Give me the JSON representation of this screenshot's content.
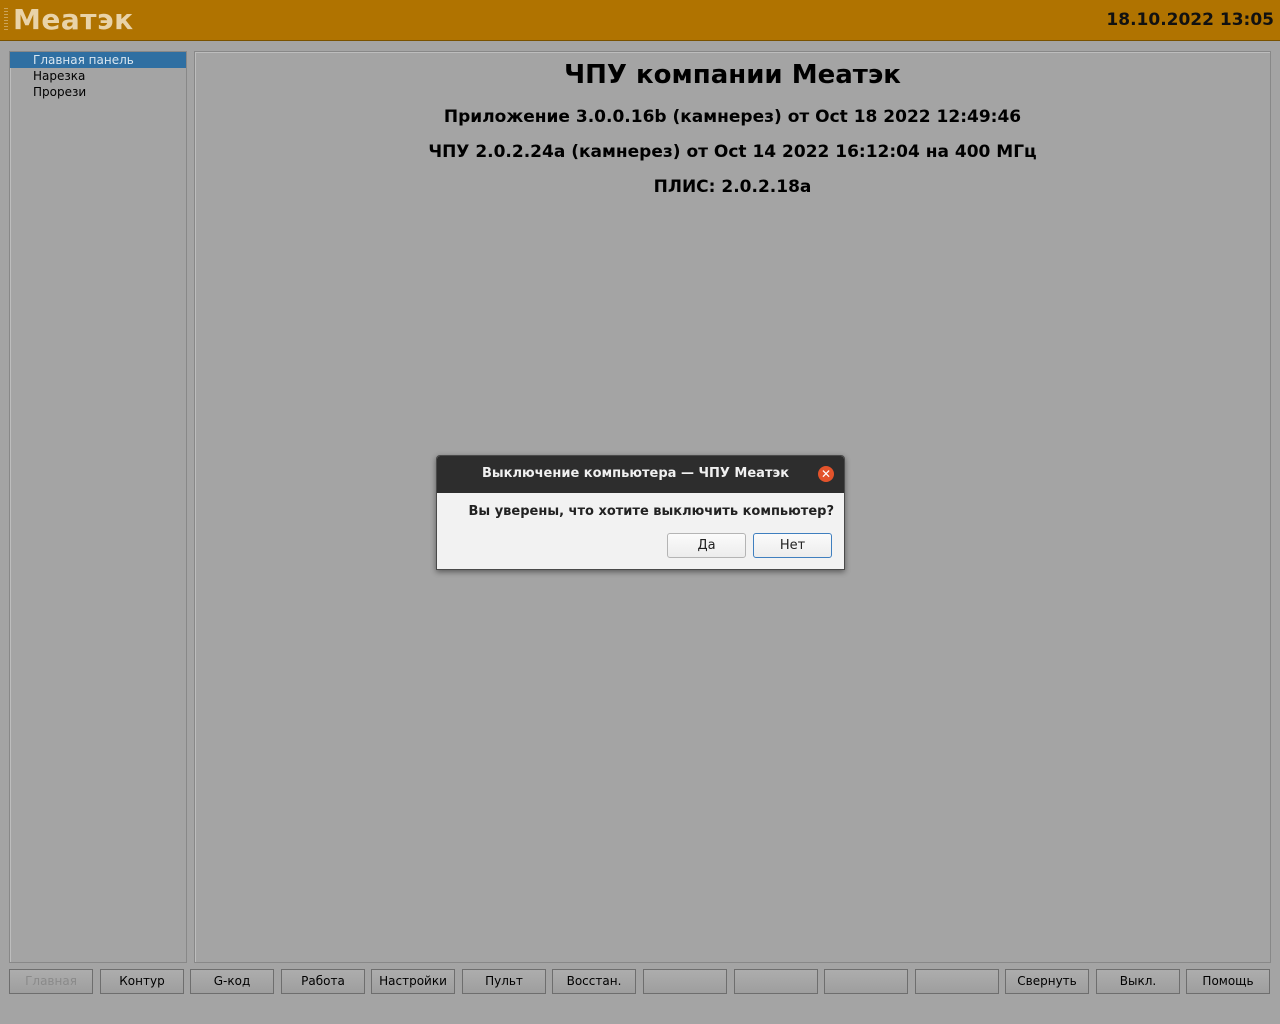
{
  "header": {
    "app_title": "Меатэк",
    "datetime": "18.10.2022 13:05"
  },
  "sidebar": {
    "items": [
      {
        "label": "Главная панель",
        "active": true
      },
      {
        "label": "Нарезка",
        "active": false
      },
      {
        "label": "Прорези",
        "active": false
      }
    ]
  },
  "main": {
    "title": "ЧПУ компании Меатэк",
    "app_version": "Приложение 3.0.0.16b (камнерез) от Oct 18 2022 12:49:46",
    "cnc_version": "ЧПУ 2.0.2.24a (камнерез) от Oct 14 2022 16:12:04 на 400 МГц",
    "fpga_version": "ПЛИС: 2.0.2.18a"
  },
  "footer": {
    "buttons": [
      "Главная",
      "Контур",
      "G-код",
      "Работа",
      "Настройки",
      "Пульт",
      "Восстан.",
      "",
      "",
      "",
      "",
      "Свернуть",
      "Выкл.",
      "Помощь"
    ],
    "disabled_index": 0
  },
  "dialog": {
    "title": "Выключение компьютера — ЧПУ Меатэк",
    "message": "Вы уверены, что хотите выключить компьютер?",
    "yes_label": "Да",
    "no_label": "Нет",
    "close_glyph": "✕"
  },
  "colors": {
    "header_bg": "#b07300",
    "background": "#a4a4a4",
    "sidebar_active": "#2f6fa2",
    "dialog_titlebar": "#2d2d2d",
    "close_button": "#e3532b"
  }
}
